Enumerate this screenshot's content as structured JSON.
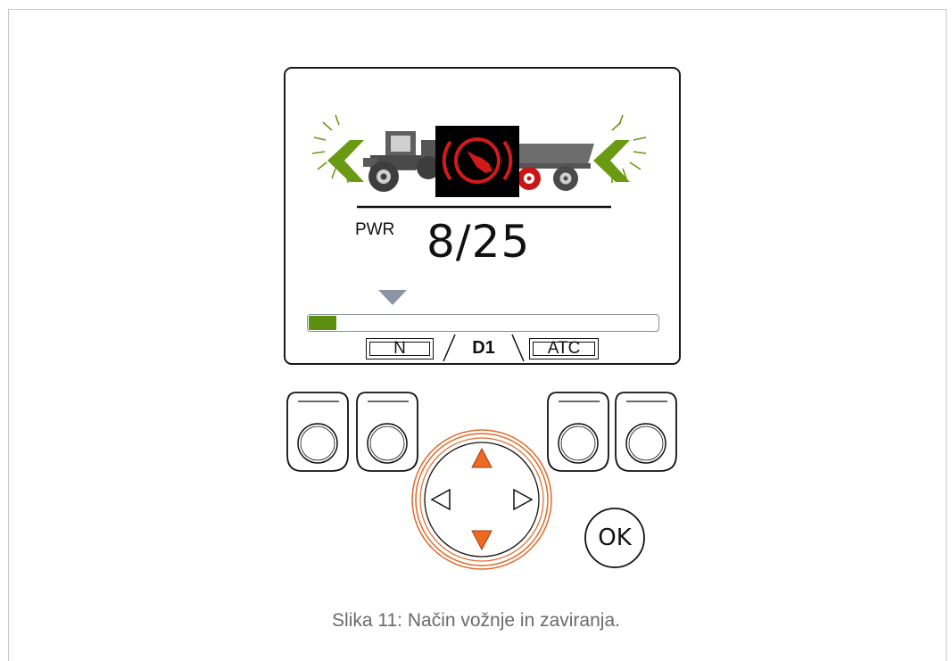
{
  "display": {
    "pwr_label": "PWR",
    "pwr_value": "8/25",
    "power_level_fraction": 0.08,
    "tabs": [
      {
        "label": "N",
        "active": false
      },
      {
        "label": "D1",
        "active": true
      },
      {
        "label": "ATC",
        "active": false
      }
    ],
    "brake_warning_active": true
  },
  "keypad": {
    "ok_label": "OK"
  },
  "caption": "Slika 11: Način vožnje in zaviranja.",
  "colors": {
    "indicator_green": "#6a9a12",
    "warning_red": "#d11a1a",
    "progress_fill": "#5a8f10",
    "pointer_gray": "#8b95a3",
    "dpad_orange": "#ee6a22"
  },
  "icons": [
    "left-arrow-icon",
    "tractor-icon",
    "brake-warning-icon",
    "trailer-icon",
    "chevron-up-icon",
    "chevron-down-icon",
    "chevron-left-icon",
    "chevron-right-icon"
  ]
}
